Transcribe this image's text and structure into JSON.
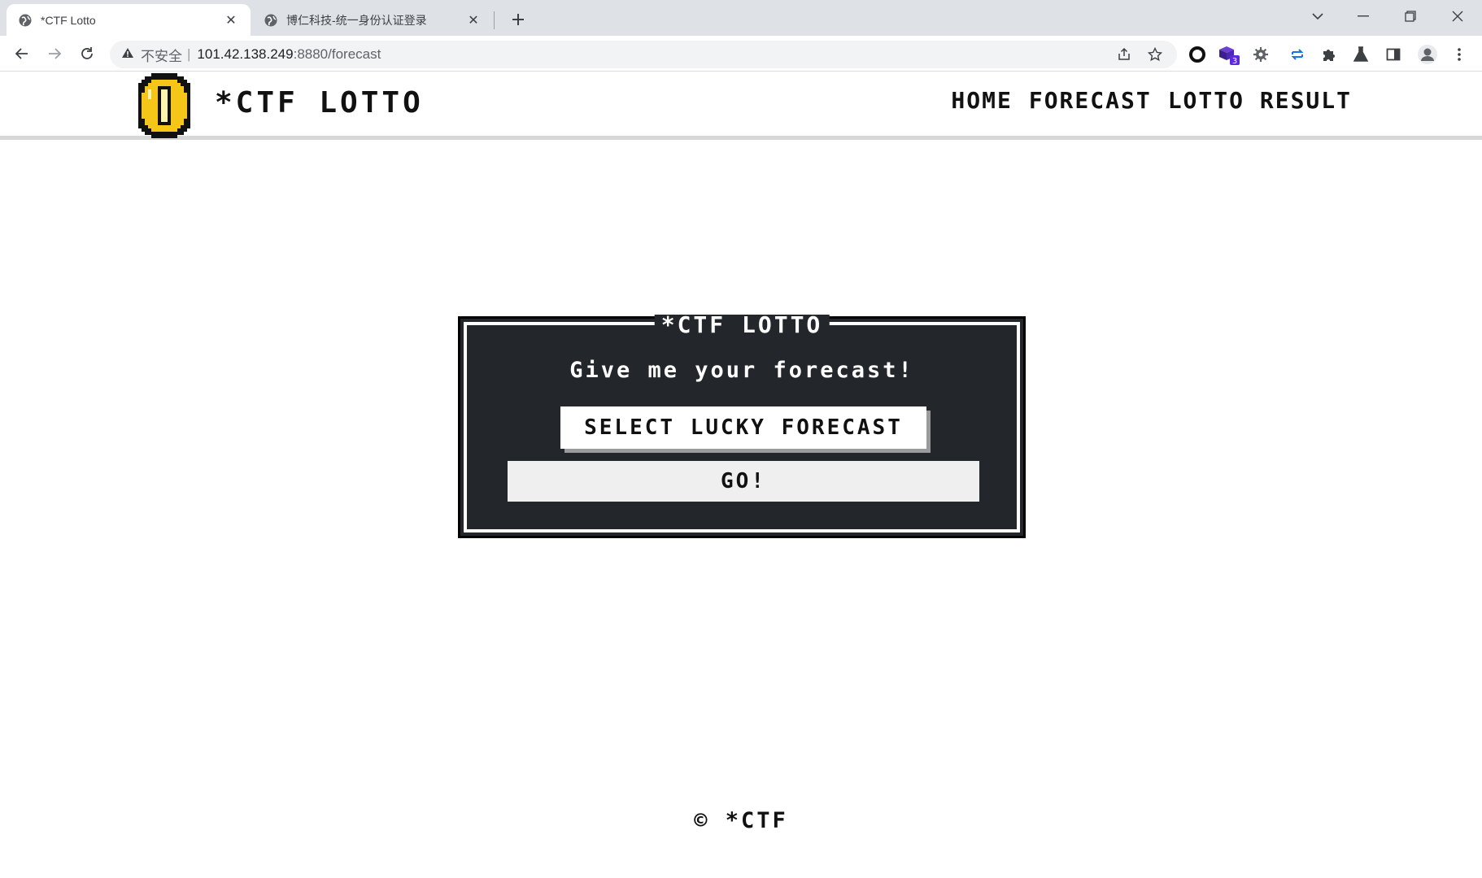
{
  "browser": {
    "tabs": [
      {
        "title": "*CTF Lotto",
        "active": true
      },
      {
        "title": "博仁科技-统一身份认证登录",
        "active": false
      }
    ],
    "url": {
      "insecure_label": "不安全",
      "host": "101.42.138.249",
      "path": ":8880/forecast"
    },
    "extension_badge": "3"
  },
  "site": {
    "brand": "*CTF LOTTO",
    "nav": [
      "HOME",
      "FORECAST",
      "LOTTO RESULT"
    ]
  },
  "panel": {
    "title": "*CTF LOTTO",
    "prompt": "Give me your forecast!",
    "select_label": "SELECT LUCKY FORECAST",
    "go_label": "GO!"
  },
  "footer": {
    "text": "© *CTF"
  },
  "colors": {
    "panel_bg": "#23262b",
    "coin_gold": "#f5c518"
  }
}
